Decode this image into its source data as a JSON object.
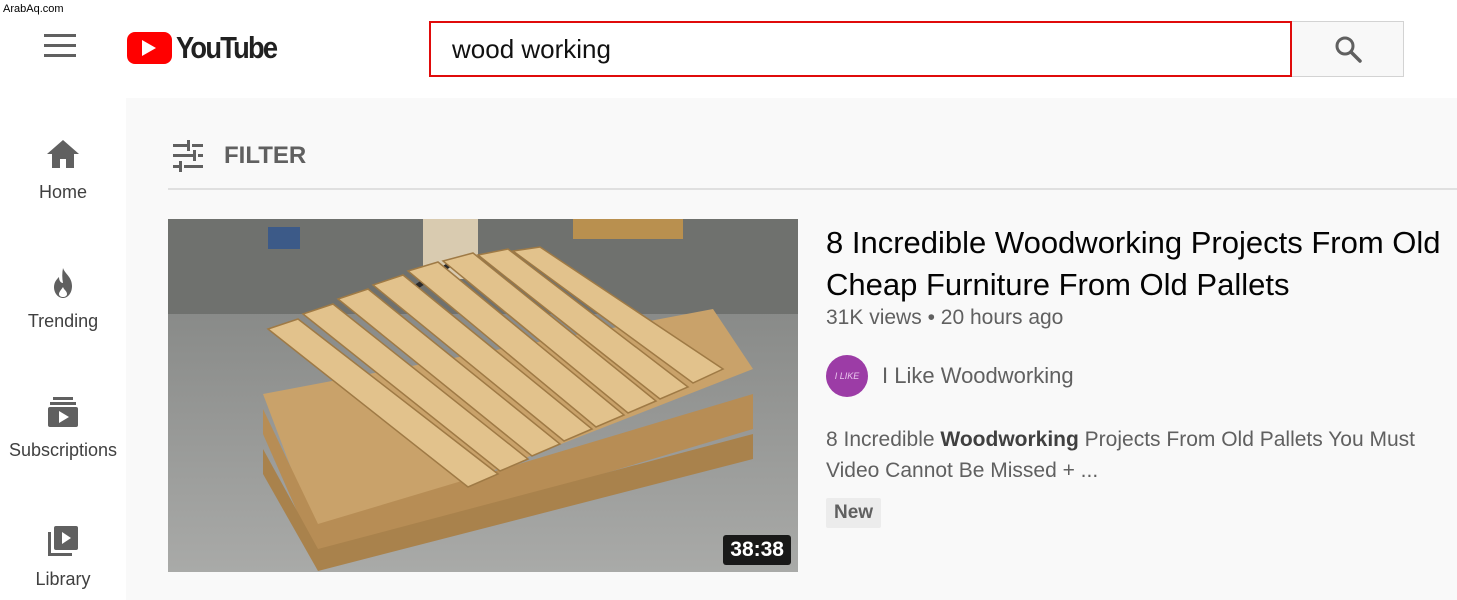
{
  "watermark": "ArabAq.com",
  "header": {
    "logo_text": "YouTube",
    "search_value": "wood working"
  },
  "sidebar": {
    "items": [
      {
        "label": "Home",
        "icon": "home-icon"
      },
      {
        "label": "Trending",
        "icon": "fire-icon"
      },
      {
        "label": "Subscriptions",
        "icon": "subscriptions-icon"
      },
      {
        "label": "Library",
        "icon": "library-icon"
      }
    ]
  },
  "filter": {
    "label": "FILTER",
    "icon": "tune-icon"
  },
  "video": {
    "title": "8 Incredible Woodworking Projects From Old Cheap Furniture From Old Pallets",
    "views": "31K views",
    "separator": "•",
    "age": "20 hours ago",
    "duration": "38:38",
    "channel_name": "I Like Woodworking",
    "avatar_text": "I LIKE",
    "description_pre": "8 Incredible ",
    "description_bold": "Woodworking",
    "description_post": " Projects From Old Pallets You Must Video Cannot Be Missed + ...",
    "badge": "New"
  },
  "colors": {
    "youtube_red": "#ff0000",
    "search_border": "#e00b0b",
    "main_bg": "#f9f9f9",
    "avatar_purple": "#9c3ca6"
  }
}
